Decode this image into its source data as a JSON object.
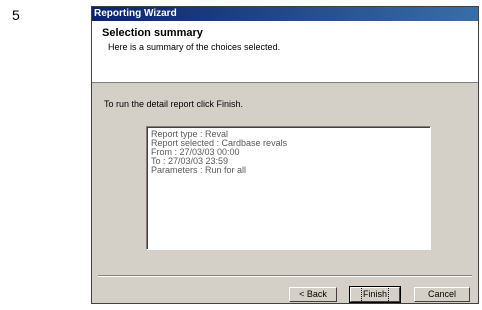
{
  "step_number": "5",
  "window": {
    "title": "Reporting Wizard"
  },
  "header": {
    "title": "Selection summary",
    "subtitle": "Here is a summary of the choices selected."
  },
  "instruction": "To run the detail report click Finish.",
  "summary": {
    "lines": [
      "Report type : Reval",
      "Report selected : Cardbase revals",
      "From : 27/03/03 00:00",
      "To : 27/03/03 23:59",
      "Parameters : Run for all"
    ]
  },
  "buttons": {
    "back": "< Back",
    "finish": "Finish",
    "cancel": "Cancel"
  },
  "colors": {
    "titlebar_start": "#0a246a",
    "titlebar_end": "#3a6ea5",
    "dialog_face": "#d4d0c8"
  }
}
